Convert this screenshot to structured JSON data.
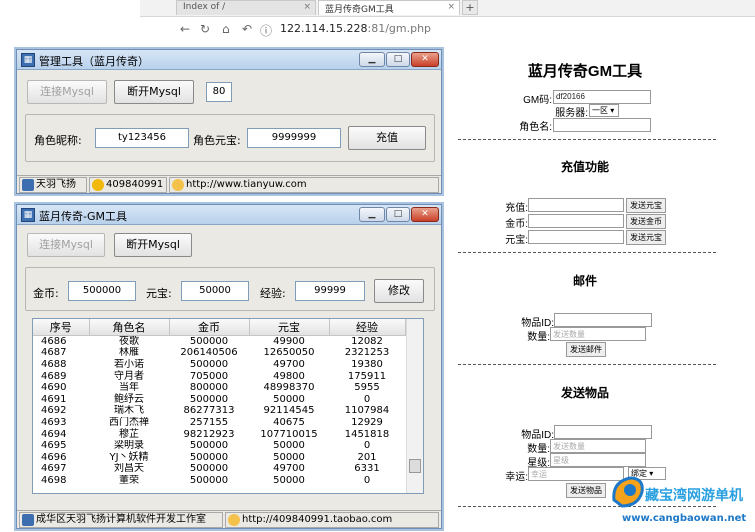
{
  "browser": {
    "tabs": [
      {
        "label": "Index of /",
        "close": "×"
      },
      {
        "label": "蓝月传奇GM工具",
        "close": "×"
      }
    ],
    "new_tab": "+",
    "url_host": "122.114.15.228",
    "url_path": ":81/gm.php"
  },
  "web": {
    "title": "蓝月传奇GM工具",
    "gm_code_label": "GM码:",
    "gm_code_value": "df20166",
    "server_label": "服务器:",
    "server_value": "一区",
    "role_name_label": "角色名:",
    "recharge_title": "充值功能",
    "recharge_label": "充值:",
    "recharge_btn": "发送元宝",
    "gold_label": "金币:",
    "gold_btn": "发送金币",
    "yuanbao_label": "元宝:",
    "yuanbao_btn": "发送元宝",
    "mail_title": "邮件",
    "mail_item_label": "物品ID:",
    "mail_qty_label": "数量:",
    "mail_qty_placeholder": "发送数量",
    "mail_send_btn": "发送邮件",
    "item_title": "发送物品",
    "item_id_label": "物品ID:",
    "item_qty_label": "数量:",
    "item_qty_placeholder": "发送数量",
    "item_star_label": "星级:",
    "item_star_placeholder": "星级",
    "item_luck_label": "幸运:",
    "item_luck_placeholder": "幸运",
    "item_bind_value": "绑定",
    "item_send_btn": "发送物品"
  },
  "win1": {
    "title": "管理工具（蓝月传奇）",
    "connect_btn": "连接Mysql",
    "disconnect_btn": "断开Mysql",
    "port": "80",
    "nick_label": "角色昵称:",
    "nick_value": "ty123456",
    "yb_label": "角色元宝:",
    "yb_value": "9999999",
    "recharge_btn": "充值",
    "status_name": "天羽飞扬",
    "status_qq": "409840991",
    "status_url": "http://www.tianyuw.com"
  },
  "win2": {
    "title": "蓝月传奇-GM工具",
    "connect_btn": "连接Mysql",
    "disconnect_btn": "断开Mysql",
    "gold_label": "金币:",
    "gold_value": "500000",
    "yb_label": "元宝:",
    "yb_value": "50000",
    "exp_label": "经验:",
    "exp_value": "99999",
    "modify_btn": "修改",
    "columns": [
      "序号",
      "角色名",
      "金币",
      "元宝",
      "经验"
    ],
    "rows": [
      [
        "4686",
        "夜歌",
        "500000",
        "49900",
        "12082"
      ],
      [
        "4687",
        "林雁",
        "206140506",
        "12650050",
        "2321253"
      ],
      [
        "4688",
        "若小诺",
        "500000",
        "49700",
        "19380"
      ],
      [
        "4689",
        "守月者",
        "705000",
        "49800",
        "175911"
      ],
      [
        "4690",
        "当年",
        "800000",
        "48998370",
        "5955"
      ],
      [
        "4691",
        "鲍纾云",
        "500000",
        "50000",
        "0"
      ],
      [
        "4692",
        "瑞木飞",
        "86277313",
        "92114545",
        "1107984"
      ],
      [
        "4693",
        "西门杰禅",
        "257155",
        "40675",
        "12929"
      ],
      [
        "4694",
        "穆芷",
        "98212923",
        "107710015",
        "1451818"
      ],
      [
        "4695",
        "梁明录",
        "500000",
        "50000",
        "0"
      ],
      [
        "4696",
        "YJ丶妖精",
        "500000",
        "50000",
        "201"
      ],
      [
        "4697",
        "刘昌天",
        "500000",
        "49700",
        "6331"
      ],
      [
        "4698",
        "董荣",
        "500000",
        "50000",
        "0"
      ]
    ],
    "status_company": "成华区天羽飞扬计算机软件开发工作室",
    "status_url": "http://409840991.taobao.com"
  },
  "watermark": {
    "text": "藏宝湾网游单机",
    "url": "www.cangbaowan.net"
  }
}
